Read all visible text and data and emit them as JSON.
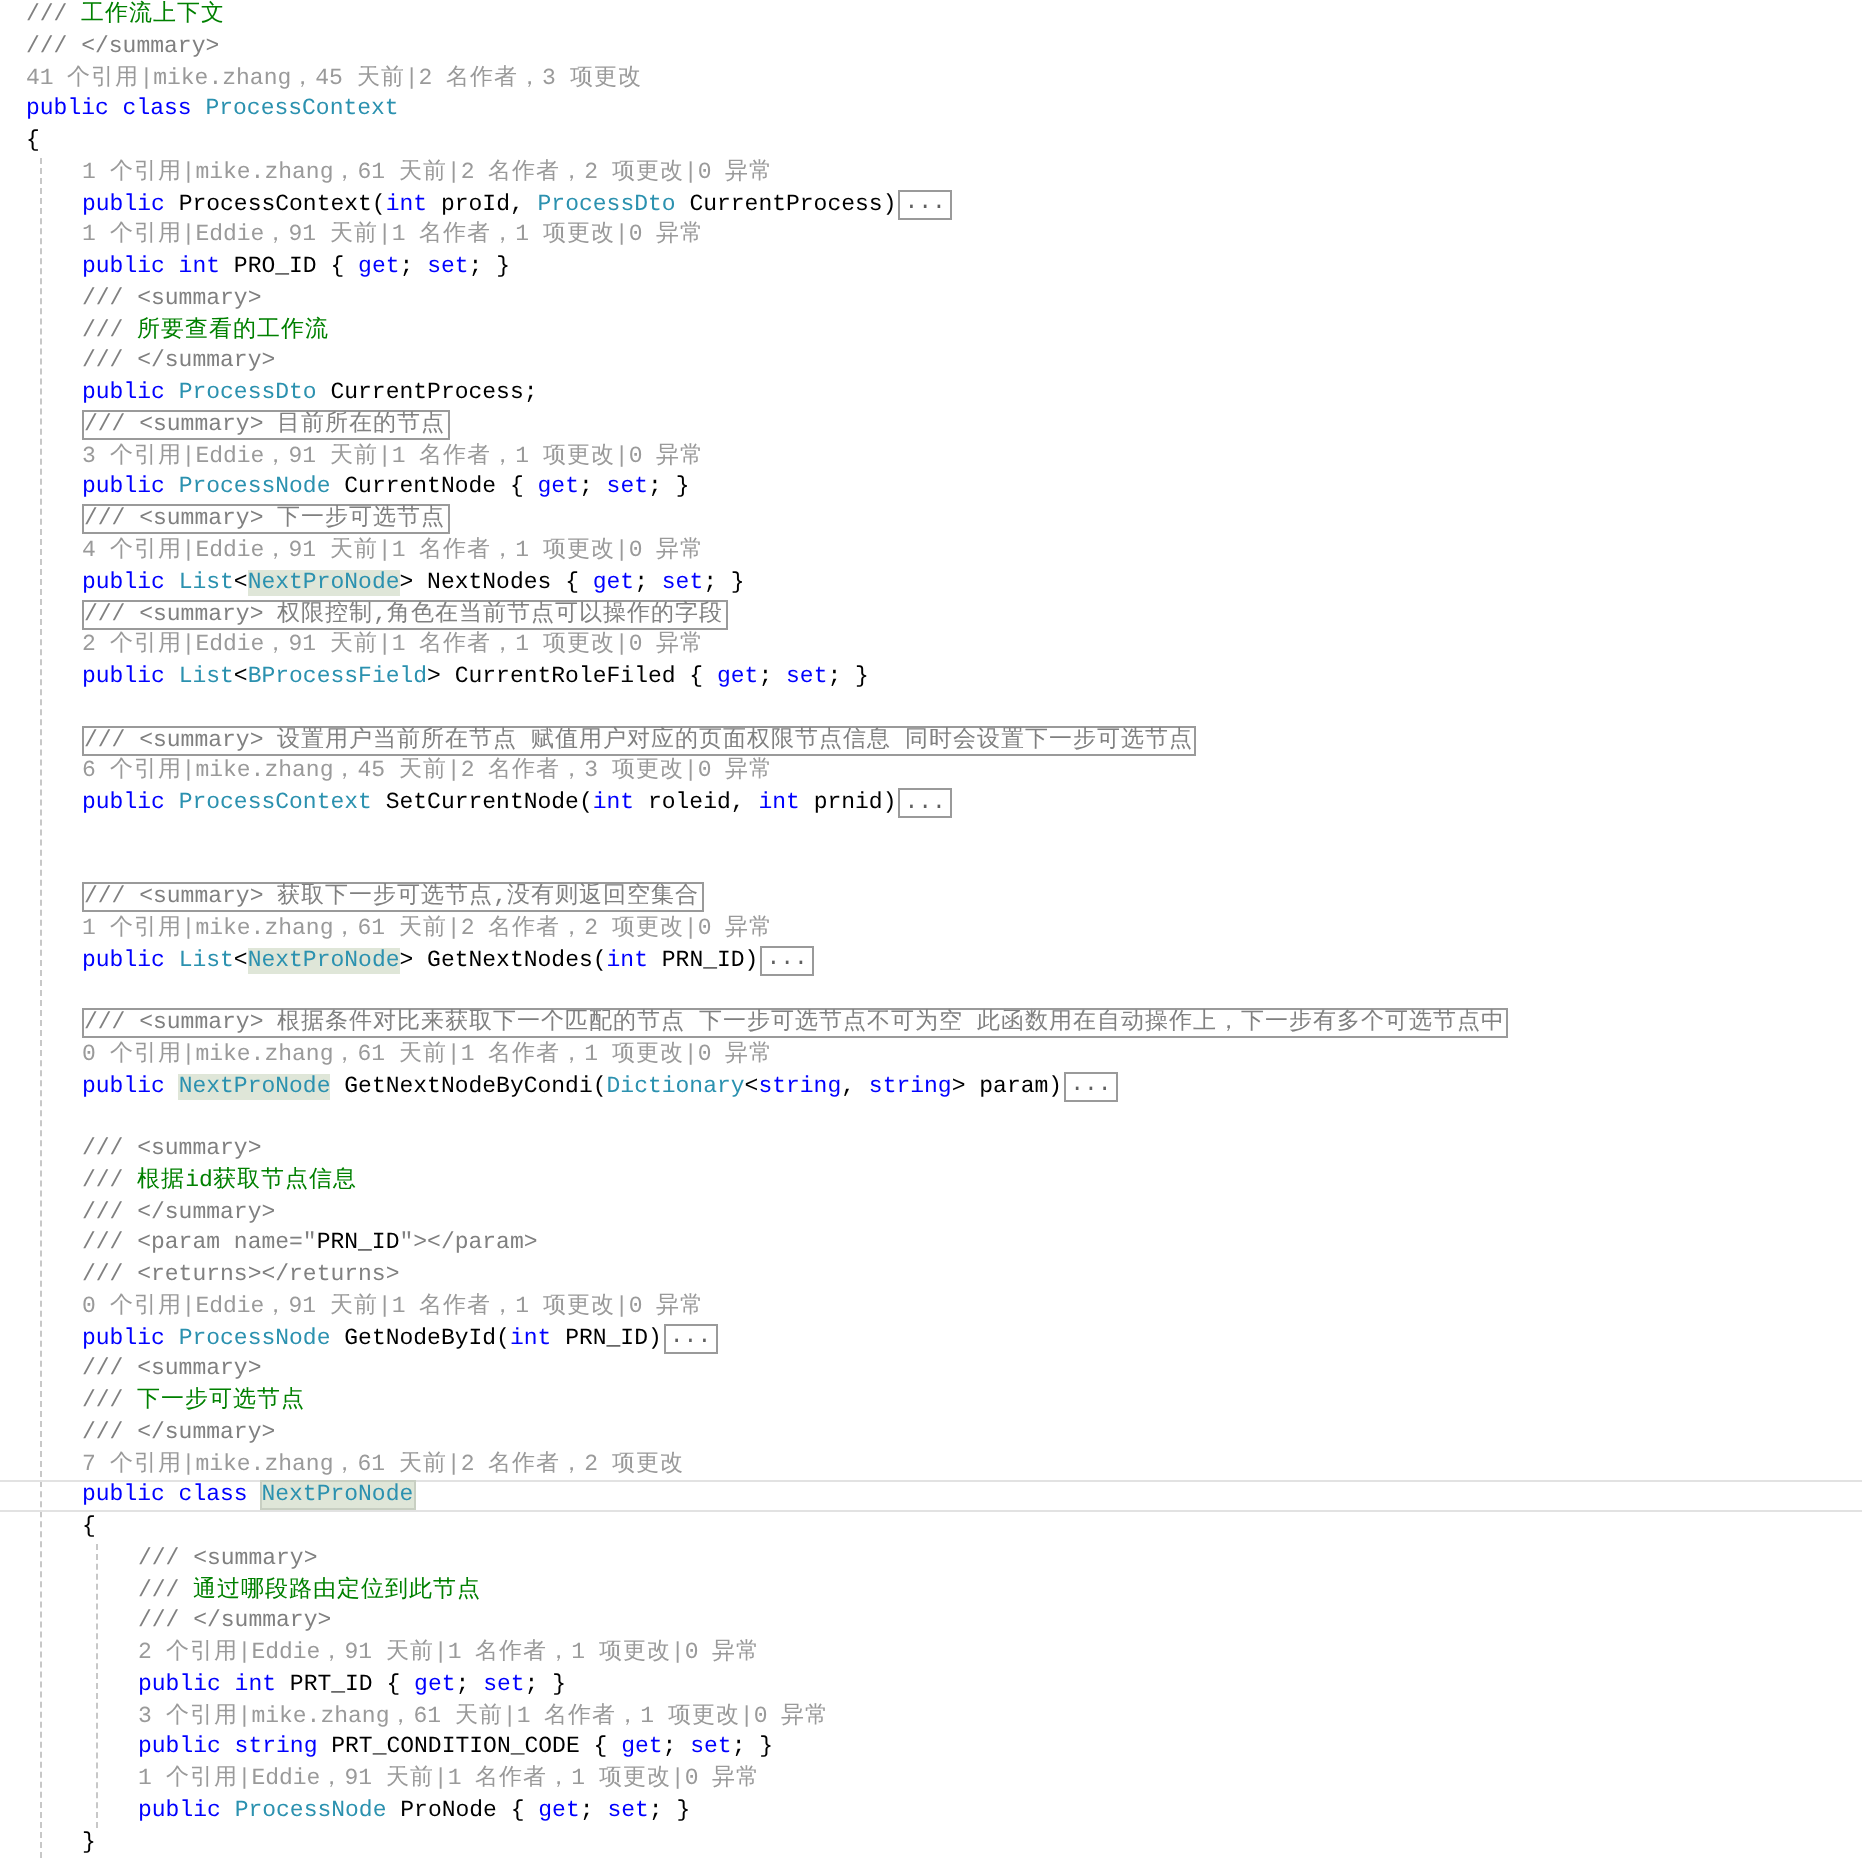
{
  "code": [
    {
      "kind": "code",
      "current": false,
      "tokens": [
        {
          "kind": "xml",
          "text": "/// "
        },
        {
          "kind": "doc",
          "text": "工作流上下文"
        }
      ]
    },
    {
      "kind": "code",
      "current": false,
      "tokens": [
        {
          "kind": "xml",
          "text": "/// </summary>"
        }
      ]
    },
    {
      "kind": "lens",
      "current": false,
      "text": "41 个引用|mike.zhang，45 天前|2 名作者，3 项更改"
    },
    {
      "kind": "code",
      "current": false,
      "tokens": [
        {
          "kind": "kw",
          "text": "public class "
        },
        {
          "kind": "type",
          "text": "ProcessContext"
        }
      ]
    },
    {
      "kind": "code",
      "current": false,
      "tokens": [
        {
          "kind": "text",
          "text": "{"
        }
      ]
    },
    {
      "kind": "block",
      "children": [
        {
          "kind": "lens",
          "current": false,
          "text": "1 个引用|mike.zhang，61 天前|2 名作者，2 项更改|0 异常"
        },
        {
          "kind": "code",
          "current": false,
          "tokens": [
            {
              "kind": "kw",
              "text": "public "
            },
            {
              "kind": "text",
              "text": "ProcessContext("
            },
            {
              "kind": "kw",
              "text": "int"
            },
            {
              "kind": "text",
              "text": " proId, "
            },
            {
              "kind": "type",
              "text": "ProcessDto"
            },
            {
              "kind": "text",
              "text": " CurrentProcess)"
            },
            {
              "kind": "fold",
              "text": "..."
            }
          ]
        },
        {
          "kind": "lens",
          "current": false,
          "text": "1 个引用|Eddie，91 天前|1 名作者，1 项更改|0 异常"
        },
        {
          "kind": "code",
          "current": false,
          "tokens": [
            {
              "kind": "kw",
              "text": "public int "
            },
            {
              "kind": "text",
              "text": "PRO_ID { "
            },
            {
              "kind": "kw",
              "text": "get"
            },
            {
              "kind": "text",
              "text": "; "
            },
            {
              "kind": "kw",
              "text": "set"
            },
            {
              "kind": "text",
              "text": "; }"
            }
          ]
        },
        {
          "kind": "code",
          "current": false,
          "tokens": [
            {
              "kind": "xml",
              "text": "/// <summary>"
            }
          ]
        },
        {
          "kind": "code",
          "current": false,
          "tokens": [
            {
              "kind": "xml",
              "text": "/// "
            },
            {
              "kind": "doc",
              "text": "所要查看的工作流"
            }
          ]
        },
        {
          "kind": "code",
          "current": false,
          "tokens": [
            {
              "kind": "xml",
              "text": "/// </summary>"
            }
          ]
        },
        {
          "kind": "code",
          "current": false,
          "tokens": [
            {
              "kind": "kw",
              "text": "public "
            },
            {
              "kind": "type",
              "text": "ProcessDto"
            },
            {
              "kind": "text",
              "text": " CurrentProcess;"
            }
          ]
        },
        {
          "kind": "collapsed",
          "current": false,
          "text": "/// <summary> 目前所在的节点"
        },
        {
          "kind": "lens",
          "current": false,
          "text": "3 个引用|Eddie，91 天前|1 名作者，1 项更改|0 异常"
        },
        {
          "kind": "code",
          "current": false,
          "tokens": [
            {
              "kind": "kw",
              "text": "public "
            },
            {
              "kind": "type",
              "text": "ProcessNode"
            },
            {
              "kind": "text",
              "text": " CurrentNode { "
            },
            {
              "kind": "kw",
              "text": "get"
            },
            {
              "kind": "text",
              "text": "; "
            },
            {
              "kind": "kw",
              "text": "set"
            },
            {
              "kind": "text",
              "text": "; }"
            }
          ]
        },
        {
          "kind": "collapsed",
          "current": false,
          "text": "/// <summary> 下一步可选节点"
        },
        {
          "kind": "lens",
          "current": false,
          "text": "4 个引用|Eddie，91 天前|1 名作者，1 项更改|0 异常"
        },
        {
          "kind": "code",
          "current": false,
          "tokens": [
            {
              "kind": "kw",
              "text": "public "
            },
            {
              "kind": "type",
              "text": "List"
            },
            {
              "kind": "text",
              "text": "<"
            },
            {
              "kind": "ref",
              "text": "NextProNode"
            },
            {
              "kind": "text",
              "text": "> NextNodes { "
            },
            {
              "kind": "kw",
              "text": "get"
            },
            {
              "kind": "text",
              "text": "; "
            },
            {
              "kind": "kw",
              "text": "set"
            },
            {
              "kind": "text",
              "text": "; }"
            }
          ]
        },
        {
          "kind": "collapsed",
          "current": false,
          "text": "/// <summary> 权限控制,角色在当前节点可以操作的字段"
        },
        {
          "kind": "lens",
          "current": false,
          "text": "2 个引用|Eddie，91 天前|1 名作者，1 项更改|0 异常"
        },
        {
          "kind": "code",
          "current": false,
          "tokens": [
            {
              "kind": "kw",
              "text": "public "
            },
            {
              "kind": "type",
              "text": "List"
            },
            {
              "kind": "text",
              "text": "<"
            },
            {
              "kind": "type",
              "text": "BProcessField"
            },
            {
              "kind": "text",
              "text": "> CurrentRoleFiled { "
            },
            {
              "kind": "kw",
              "text": "get"
            },
            {
              "kind": "text",
              "text": "; "
            },
            {
              "kind": "kw",
              "text": "set"
            },
            {
              "kind": "text",
              "text": "; }"
            }
          ]
        },
        {
          "kind": "blank",
          "current": false
        },
        {
          "kind": "collapsed",
          "current": false,
          "text": "/// <summary> 设置用户当前所在节点 赋值用户对应的页面权限节点信息 同时会设置下一步可选节点"
        },
        {
          "kind": "lens",
          "current": false,
          "text": "6 个引用|mike.zhang，45 天前|2 名作者，3 项更改|0 异常"
        },
        {
          "kind": "code",
          "current": false,
          "tokens": [
            {
              "kind": "kw",
              "text": "public "
            },
            {
              "kind": "type",
              "text": "ProcessContext"
            },
            {
              "kind": "text",
              "text": " SetCurrentNode("
            },
            {
              "kind": "kw",
              "text": "int"
            },
            {
              "kind": "text",
              "text": " roleid, "
            },
            {
              "kind": "kw",
              "text": "int"
            },
            {
              "kind": "text",
              "text": " prnid)"
            },
            {
              "kind": "fold",
              "text": "..."
            }
          ]
        },
        {
          "kind": "blank",
          "current": false
        },
        {
          "kind": "blank",
          "current": false
        },
        {
          "kind": "collapsed",
          "current": false,
          "text": "/// <summary> 获取下一步可选节点,没有则返回空集合"
        },
        {
          "kind": "lens",
          "current": false,
          "text": "1 个引用|mike.zhang，61 天前|2 名作者，2 项更改|0 异常"
        },
        {
          "kind": "code",
          "current": false,
          "tokens": [
            {
              "kind": "kw",
              "text": "public "
            },
            {
              "kind": "type",
              "text": "List"
            },
            {
              "kind": "text",
              "text": "<"
            },
            {
              "kind": "ref",
              "text": "NextProNode"
            },
            {
              "kind": "text",
              "text": "> GetNextNodes("
            },
            {
              "kind": "kw",
              "text": "int"
            },
            {
              "kind": "text",
              "text": " PRN_ID)"
            },
            {
              "kind": "fold",
              "text": "..."
            }
          ]
        },
        {
          "kind": "blank",
          "current": false
        },
        {
          "kind": "collapsed",
          "current": false,
          "text": "/// <summary> 根据条件对比来获取下一个匹配的节点 下一步可选节点不可为空 此函数用在自动操作上，下一步有多个可选节点中"
        },
        {
          "kind": "lens",
          "current": false,
          "text": "0 个引用|mike.zhang，61 天前|1 名作者，1 项更改|0 异常"
        },
        {
          "kind": "code",
          "current": false,
          "tokens": [
            {
              "kind": "kw",
              "text": "public "
            },
            {
              "kind": "ref",
              "text": "NextProNode"
            },
            {
              "kind": "text",
              "text": " GetNextNodeByCondi("
            },
            {
              "kind": "type",
              "text": "Dictionary"
            },
            {
              "kind": "text",
              "text": "<"
            },
            {
              "kind": "kw",
              "text": "string"
            },
            {
              "kind": "text",
              "text": ", "
            },
            {
              "kind": "kw",
              "text": "string"
            },
            {
              "kind": "text",
              "text": "> param)"
            },
            {
              "kind": "fold",
              "text": "..."
            }
          ]
        },
        {
          "kind": "blank",
          "current": false
        },
        {
          "kind": "code",
          "current": false,
          "tokens": [
            {
              "kind": "xml",
              "text": "/// <summary>"
            }
          ]
        },
        {
          "kind": "code",
          "current": false,
          "tokens": [
            {
              "kind": "xml",
              "text": "/// "
            },
            {
              "kind": "doc",
              "text": "根据id获取节点信息"
            }
          ]
        },
        {
          "kind": "code",
          "current": false,
          "tokens": [
            {
              "kind": "xml",
              "text": "/// </summary>"
            }
          ]
        },
        {
          "kind": "code",
          "current": false,
          "tokens": [
            {
              "kind": "xml",
              "text": "/// <param name=\""
            },
            {
              "kind": "text",
              "text": "PRN_ID"
            },
            {
              "kind": "xml",
              "text": "\"></param>"
            }
          ]
        },
        {
          "kind": "code",
          "current": false,
          "tokens": [
            {
              "kind": "xml",
              "text": "/// <returns></returns>"
            }
          ]
        },
        {
          "kind": "lens",
          "current": false,
          "text": "0 个引用|Eddie，91 天前|1 名作者，1 项更改|0 异常"
        },
        {
          "kind": "code",
          "current": false,
          "tokens": [
            {
              "kind": "kw",
              "text": "public "
            },
            {
              "kind": "type",
              "text": "ProcessNode"
            },
            {
              "kind": "text",
              "text": " GetNodeById("
            },
            {
              "kind": "kw",
              "text": "int"
            },
            {
              "kind": "text",
              "text": " PRN_ID)"
            },
            {
              "kind": "fold",
              "text": "..."
            }
          ]
        },
        {
          "kind": "code",
          "current": false,
          "tokens": [
            {
              "kind": "xml",
              "text": "/// <summary>"
            }
          ]
        },
        {
          "kind": "code",
          "current": false,
          "tokens": [
            {
              "kind": "xml",
              "text": "/// "
            },
            {
              "kind": "doc",
              "text": "下一步可选节点"
            }
          ]
        },
        {
          "kind": "code",
          "current": false,
          "tokens": [
            {
              "kind": "xml",
              "text": "/// </summary>"
            }
          ]
        },
        {
          "kind": "lens",
          "current": false,
          "text": "7 个引用|mike.zhang，61 天前|2 名作者，2 项更改"
        },
        {
          "kind": "code",
          "current": true,
          "tokens": [
            {
              "kind": "kw",
              "text": "public class "
            },
            {
              "kind": "ref",
              "text": "NextProNode"
            }
          ]
        },
        {
          "kind": "code",
          "current": false,
          "tokens": [
            {
              "kind": "text",
              "text": "{"
            }
          ]
        },
        {
          "kind": "block",
          "children": [
            {
              "kind": "code",
              "current": false,
              "tokens": [
                {
                  "kind": "xml",
                  "text": "/// <summary>"
                }
              ]
            },
            {
              "kind": "code",
              "current": false,
              "tokens": [
                {
                  "kind": "xml",
                  "text": "/// "
                },
                {
                  "kind": "doc",
                  "text": "通过哪段路由定位到此节点"
                }
              ]
            },
            {
              "kind": "code",
              "current": false,
              "tokens": [
                {
                  "kind": "xml",
                  "text": "/// </summary>"
                }
              ]
            },
            {
              "kind": "lens",
              "current": false,
              "text": "2 个引用|Eddie，91 天前|1 名作者，1 项更改|0 异常"
            },
            {
              "kind": "code",
              "current": false,
              "tokens": [
                {
                  "kind": "kw",
                  "text": "public int "
                },
                {
                  "kind": "text",
                  "text": "PRT_ID { "
                },
                {
                  "kind": "kw",
                  "text": "get"
                },
                {
                  "kind": "text",
                  "text": "; "
                },
                {
                  "kind": "kw",
                  "text": "set"
                },
                {
                  "kind": "text",
                  "text": "; }"
                }
              ]
            },
            {
              "kind": "lens",
              "current": false,
              "text": "3 个引用|mike.zhang，61 天前|1 名作者，1 项更改|0 异常"
            },
            {
              "kind": "code",
              "current": false,
              "tokens": [
                {
                  "kind": "kw",
                  "text": "public string "
                },
                {
                  "kind": "text",
                  "text": "PRT_CONDITION_CODE { "
                },
                {
                  "kind": "kw",
                  "text": "get"
                },
                {
                  "kind": "text",
                  "text": "; "
                },
                {
                  "kind": "kw",
                  "text": "set"
                },
                {
                  "kind": "text",
                  "text": "; }"
                }
              ]
            },
            {
              "kind": "lens",
              "current": false,
              "text": "1 个引用|Eddie，91 天前|1 名作者，1 项更改|0 异常"
            },
            {
              "kind": "code",
              "current": false,
              "tokens": [
                {
                  "kind": "kw",
                  "text": "public "
                },
                {
                  "kind": "type",
                  "text": "ProcessNode"
                },
                {
                  "kind": "text",
                  "text": " ProNode { "
                },
                {
                  "kind": "kw",
                  "text": "get"
                },
                {
                  "kind": "text",
                  "text": "; "
                },
                {
                  "kind": "kw",
                  "text": "set"
                },
                {
                  "kind": "text",
                  "text": "; }"
                }
              ]
            }
          ]
        },
        {
          "kind": "code",
          "current": false,
          "tokens": [
            {
              "kind": "text",
              "text": "}"
            }
          ]
        }
      ]
    }
  ]
}
